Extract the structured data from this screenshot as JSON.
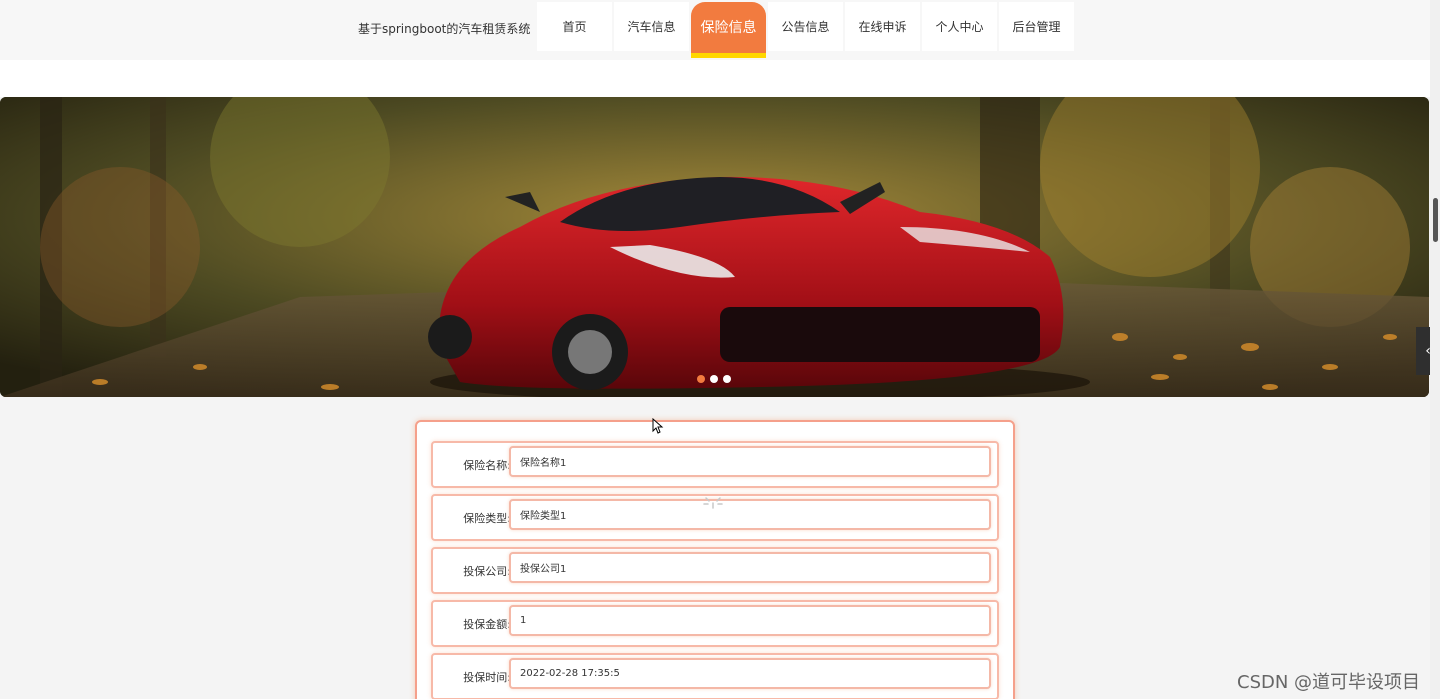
{
  "site_title": "基于springboot的汽车租赁系统",
  "nav": [
    {
      "label": "首页",
      "active": false
    },
    {
      "label": "汽车信息",
      "active": false
    },
    {
      "label": "保险信息",
      "active": true
    },
    {
      "label": "公告信息",
      "active": false
    },
    {
      "label": "在线申诉",
      "active": false
    },
    {
      "label": "个人中心",
      "active": false
    },
    {
      "label": "后台管理",
      "active": false
    }
  ],
  "banner": {
    "slide_count": 3,
    "active_slide": 1
  },
  "form": {
    "fields": [
      {
        "label": "保险名称:",
        "value": "保险名称1"
      },
      {
        "label": "保险类型:",
        "value": "保险类型1"
      },
      {
        "label": "投保公司:",
        "value": "投保公司1"
      },
      {
        "label": "投保金额:",
        "value": "1"
      },
      {
        "label": "投保时间:",
        "value": "2022-02-28 17:35:5"
      }
    ]
  },
  "side_arrow": "‹",
  "watermark": "CSDN @道可毕设项目",
  "colors": {
    "accent": "#f27b3f",
    "accent_underline": "#ffd700",
    "field_border": "#f4b8a7"
  }
}
